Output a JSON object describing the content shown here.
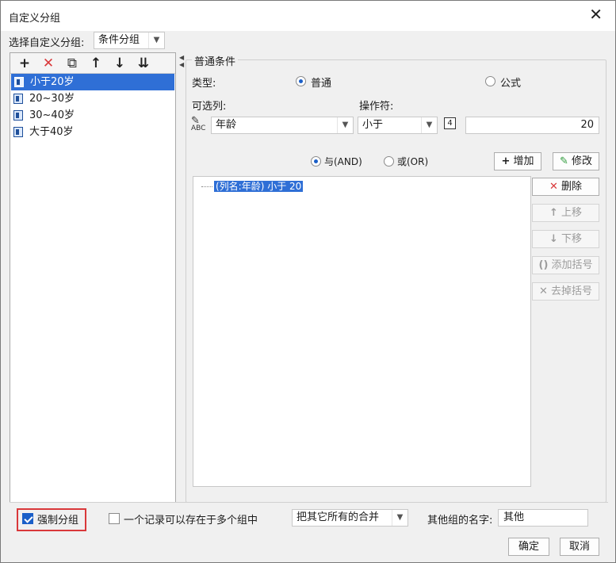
{
  "dialog": {
    "title": "自定义分组",
    "close_glyph": "✕"
  },
  "group_select": {
    "label": "选择自定义分组:",
    "value": "条件分组"
  },
  "toolbar": {
    "add_glyph": "+",
    "delete_glyph": "✕",
    "copy_glyph": "⧉",
    "up_glyph": "↑",
    "down_glyph": "↓",
    "sort_glyph": "⇊"
  },
  "groups": [
    {
      "label": "小于20岁",
      "selected": true
    },
    {
      "label": "20~30岁",
      "selected": false
    },
    {
      "label": "30~40岁",
      "selected": false
    },
    {
      "label": "大于40岁",
      "selected": false
    }
  ],
  "condition": {
    "section_title": "普通条件",
    "type_label": "类型:",
    "type_options": {
      "normal": "普通",
      "formula": "公式",
      "selected": "普通"
    },
    "column_label": "可选列:",
    "column_icon_text": "ABC",
    "column_value": "年龄",
    "operator_label": "操作符:",
    "operator_value": "小于",
    "value_type_icon": "4",
    "value": "20",
    "logic": {
      "and": "与(AND)",
      "or": "或(OR)",
      "selected": "与(AND)"
    },
    "add_button": "增加",
    "modify_button": "修改",
    "items": [
      "(列名:年龄) 小于 20"
    ]
  },
  "side_buttons": {
    "delete": "删除",
    "move_up": "上移",
    "move_down": "下移",
    "add_bracket": "添加括号",
    "remove_bracket": "去掉括号"
  },
  "bottom": {
    "force_group_label": "强制分组",
    "force_group_checked": true,
    "multi_group_label": "一个记录可以存在于多个组中",
    "multi_group_checked": false,
    "others_mode": "把其它所有的合并",
    "others_name_label": "其他组的名字:",
    "others_name_value": "其他",
    "ok_button": "确定",
    "cancel_button": "取消"
  },
  "colors": {
    "selection": "#2f6fd6",
    "delete_red": "#d9383a",
    "highlight_outline": "#d9383a"
  }
}
